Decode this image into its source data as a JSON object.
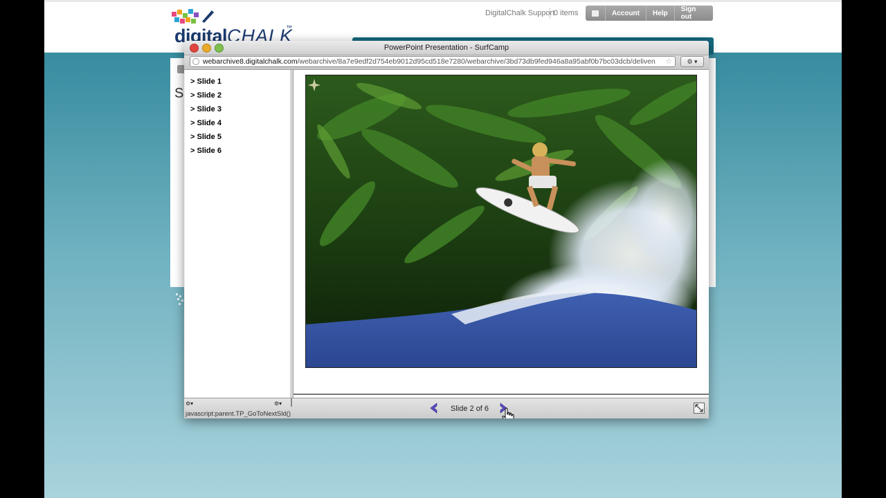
{
  "site": {
    "logo_main": "digital",
    "logo_chalk": "CHALK",
    "logo_tm": "™",
    "support_link": "DigitalChalk Support",
    "cart_count": "0 items",
    "nav": [
      "Account",
      "Help",
      "Sign out"
    ],
    "content_heading_initial": "S"
  },
  "popup": {
    "window_title": "PowerPoint Presentation - SurfCamp",
    "url_host": "webarchive8.digitalchalk.com",
    "url_path": "/webarchive/8a7e9edf2d754eb9012d95cd518e7280/webarchive/3bd73db9fed946a8a95abf0b7bc03dcb/deliven",
    "outline": [
      "> Slide 1",
      "> Slide 2",
      "> Slide 3",
      "> Slide 4",
      "> Slide 5",
      "> Slide 6"
    ],
    "status_url": "javascript:parent.TP_GoToNextSld()",
    "slide_counter": "Slide 2 of 6",
    "current_slide": 2,
    "total_slides": 6
  },
  "colors": {
    "brand_teal": "#16697f",
    "logo_navy": "#1a3a6e",
    "nav_arrow": "#5b4fc0"
  },
  "icons": [
    "home-icon",
    "globe-icon",
    "bookmark-star-icon",
    "prev-arrow-icon",
    "next-arrow-icon",
    "hand-cursor-icon",
    "resize-icon"
  ]
}
